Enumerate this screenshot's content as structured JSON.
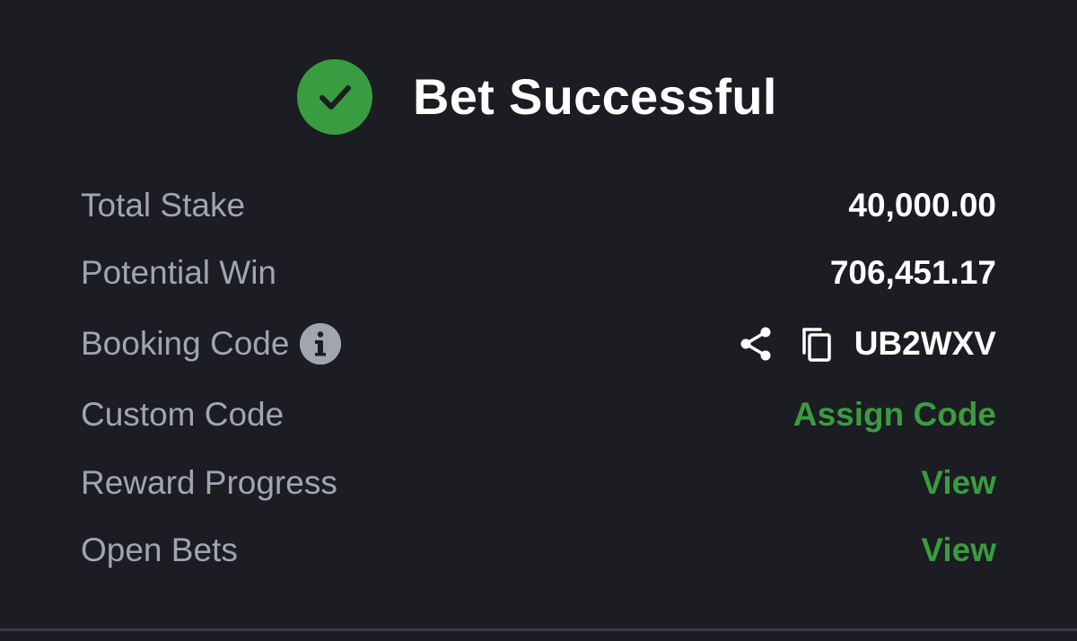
{
  "header": {
    "title": "Bet Successful",
    "icon": "check-circle-icon"
  },
  "summary": {
    "total_stake": {
      "label": "Total Stake",
      "value": "40,000.00"
    },
    "potential_win": {
      "label": "Potential Win",
      "value": "706,451.17"
    },
    "booking_code": {
      "label": "Booking Code",
      "value": "UB2WXV",
      "icons": [
        "info-icon",
        "share-icon",
        "copy-icon"
      ]
    },
    "custom_code": {
      "label": "Custom Code",
      "action": "Assign Code"
    },
    "reward_progress": {
      "label": "Reward Progress",
      "action": "View"
    },
    "open_bets": {
      "label": "Open Bets",
      "action": "View"
    }
  },
  "colors": {
    "background": "#1c1d22",
    "accent_green": "#3a9c40",
    "label_gray": "#a1a5ae",
    "value_white": "#ffffff"
  }
}
